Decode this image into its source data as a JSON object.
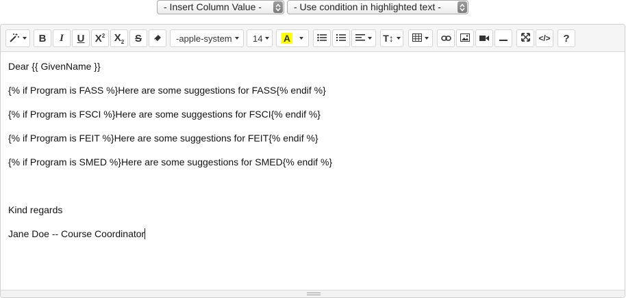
{
  "top_controls": {
    "insert_column": "- Insert Column Value -",
    "use_condition": "- Use condition in highlighted text -"
  },
  "toolbar": {
    "font_family": "-apple-system",
    "font_size": "14",
    "help": "?"
  },
  "editor": {
    "lines": [
      "Dear {{ GivenName }}",
      "{% if Program is FASS %}Here are some suggestions for FASS{% endif %}",
      "{% if Program is FSCI %}Here are some suggestions for FSCI{% endif %}",
      "{% if Program is FEIT %}Here are some suggestions for FEIT{% endif %}",
      "{% if Program is SMED %}Here are some suggestions for SMED{% endif %}",
      "",
      "Kind regards",
      "Jane Doe -- Course Coordinator"
    ]
  },
  "colors": {
    "highlight_yellow": "#ffff00",
    "toolbar_bg": "#f5f5f5"
  }
}
